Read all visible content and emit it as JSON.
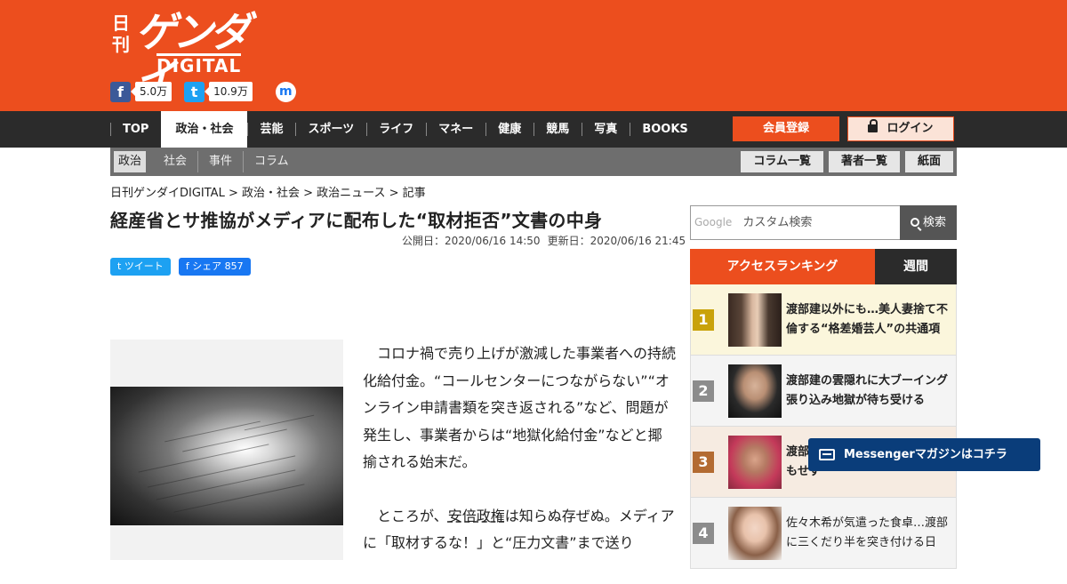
{
  "header": {
    "logo_small": "日刊",
    "logo_main": "ゲンダイ",
    "logo_sub": "DIGITAL",
    "facebook_count": "5.0万",
    "twitter_count": "10.9万",
    "facebook_icon": "f",
    "twitter_icon": "t",
    "messenger_icon": "m"
  },
  "nav": {
    "items": [
      "TOP",
      "政治・社会",
      "芸能",
      "スポーツ",
      "ライフ",
      "マネー",
      "健康",
      "競馬",
      "写真",
      "BOOKS"
    ],
    "active": "政治・社会",
    "register": "会員登録",
    "login": "ログイン"
  },
  "subnav": {
    "items": [
      "政治",
      "社会",
      "事件",
      "コラム"
    ],
    "buttons": [
      "コラム一覧",
      "著者一覧",
      "紙面"
    ]
  },
  "article": {
    "breadcrumb": "日刊ゲンダイDIGITAL > 政治・社会 > 政治ニュース > 記事",
    "title": "経産省とサ推協がメディアに配布した“取材拒否”文書の中身",
    "published": "公開日：2020/06/16 14:50",
    "updated": "更新日：2020/06/16 21:45",
    "tweet": "ツイート",
    "share": "シェア 857",
    "para1": "コロナ禍で売り上げが激減した事業者への持続化給付金。“コールセンターにつながらない”“オンライン申請書類を突き返される”など、問題が発生し、事業者からは“地獄化給付金”などと揶揄される始末だ。",
    "para2_a": "ところが、",
    "para2_link": "安倍政権",
    "para2_b": "は知らぬ存ぜぬ。メディアに「取材するな！」と“圧力文書”まで送り"
  },
  "sidebar": {
    "search_brand": "Google",
    "search_placeholder": "カスタム検索",
    "search_button": "検索",
    "tab_access": "アクセスランキング",
    "tab_weekly": "週間",
    "ranking": [
      {
        "num": "1",
        "text": "渡部建以外にも…美人妻捨て不倫する“格差婚芸人”の共通項"
      },
      {
        "num": "2",
        "text": "渡部建の雲隠れに大ブーイング 張り込み地獄が待ち受ける"
      },
      {
        "num": "3",
        "text": "渡部建の…警察ロケでの夜遊びもせず"
      },
      {
        "num": "4",
        "text": "佐々木希が気遣った食卓…渡部に三くだり半を突き付ける日"
      }
    ]
  },
  "messenger": {
    "label": "Messengerマガジンはコチラ"
  },
  "colors": {
    "brand": "#ec4e1e",
    "nav": "#2b2b2b",
    "rank1": "#c9a20a",
    "rank2": "#8c8c8c",
    "rank3": "#b36b32",
    "rank4": "#8c8c8c"
  }
}
